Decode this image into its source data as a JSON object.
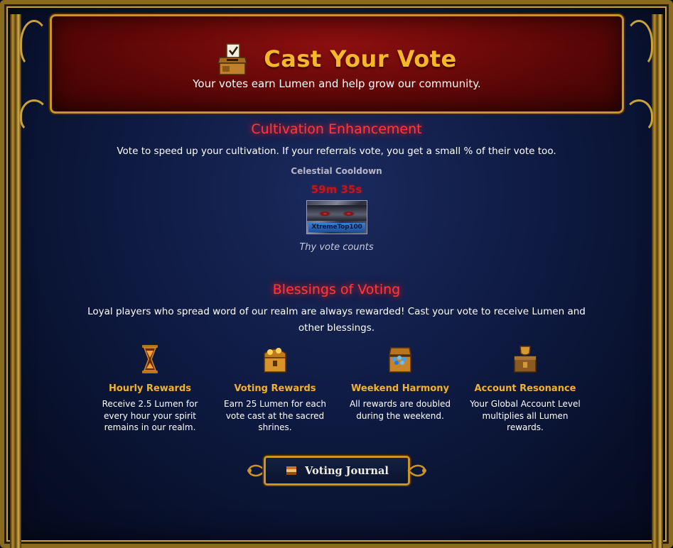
{
  "header": {
    "title": "Cast Your Vote",
    "subtitle": "Your votes earn Lumen and help grow our community."
  },
  "cultivation": {
    "title": "Cultivation Enhancement",
    "description": "Vote to speed up your cultivation. If your referrals vote, you get a small % of their vote too.",
    "cooldown_label": "Celestial Cooldown",
    "cooldown_value": "59m 35s",
    "vote_site": "XtremeTop100",
    "vote_caption": "Thy vote counts"
  },
  "blessings": {
    "title": "Blessings of Voting",
    "description": "Loyal players who spread word of our realm are always rewarded! Cast your vote to receive Lumen and other blessings.",
    "features": [
      {
        "icon": "hourglass-icon",
        "title": "Hourly Rewards",
        "text": "Receive 2.5 Lumen for every hour your spirit remains in our realm."
      },
      {
        "icon": "treasure-chest-icon",
        "title": "Voting Rewards",
        "text": "Earn 25 Lumen for each vote cast at the sacred shrines."
      },
      {
        "icon": "gem-chest-icon",
        "title": "Weekend Harmony",
        "text": "All rewards are doubled during the weekend."
      },
      {
        "icon": "trophy-chest-icon",
        "title": "Account Resonance",
        "text": "Your Global Account Level multiplies all Lumen rewards."
      }
    ]
  },
  "journal_button": {
    "label": "Voting Journal",
    "icon": "book-icon"
  },
  "colors": {
    "gold": "#f6b62c",
    "red_glow": "#ff3a3a",
    "banner_red": "#8c0f0f",
    "background_navy": "#0e1a42"
  }
}
